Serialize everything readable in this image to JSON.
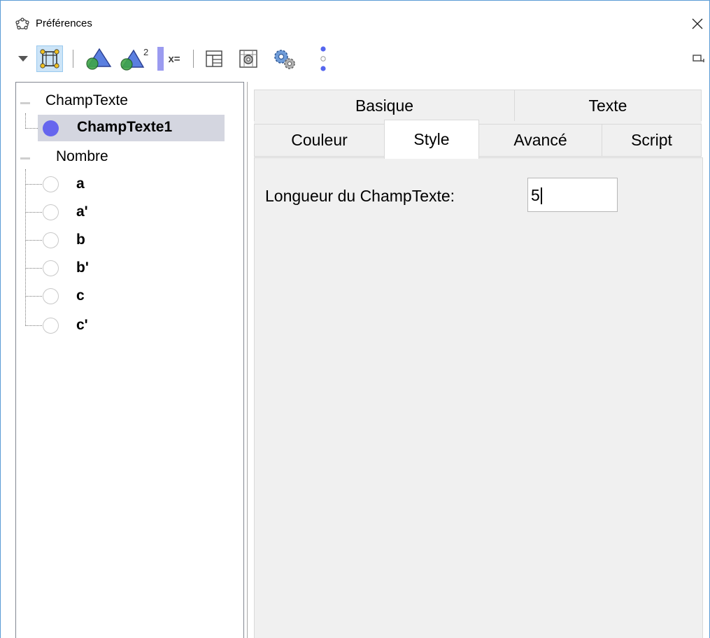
{
  "window": {
    "title": "Préférences",
    "accent_color": "#5a9bd5"
  },
  "toolbar": {
    "items": [
      {
        "name": "dropdown",
        "icon": "triangle-down-icon"
      },
      {
        "name": "graphics",
        "icon": "graphics-view-icon",
        "selected": true
      },
      {
        "name": "graphics-3d",
        "icon": "pyramid-icon"
      },
      {
        "name": "graphics-3d-2",
        "icon": "pyramid-squared-icon",
        "superscript": "2"
      },
      {
        "name": "algebra",
        "icon": "algebra-icon",
        "label": "x="
      },
      {
        "name": "layout",
        "icon": "layout-icon"
      },
      {
        "name": "graphics-settings",
        "icon": "graphics-settings-icon"
      },
      {
        "name": "advanced",
        "icon": "gears-icon"
      },
      {
        "name": "more",
        "icon": "more-vertical-icon"
      },
      {
        "name": "undock",
        "icon": "undock-icon"
      }
    ]
  },
  "tree": {
    "groups": [
      {
        "label": "ChampTexte",
        "children": [
          {
            "label": "ChampTexte1",
            "selected": true,
            "visible": true
          }
        ]
      },
      {
        "label": "Nombre",
        "children": [
          {
            "label": "a",
            "visible": false
          },
          {
            "label": "a'",
            "visible": false
          },
          {
            "label": "b",
            "visible": false
          },
          {
            "label": "b'",
            "visible": false
          },
          {
            "label": "c",
            "visible": false
          },
          {
            "label": "c'",
            "visible": false
          }
        ]
      }
    ],
    "selected_dot_color": "#6666ee"
  },
  "tabs": {
    "row1": [
      {
        "label": "Basique"
      },
      {
        "label": "Texte"
      }
    ],
    "row2": [
      {
        "label": "Couleur"
      },
      {
        "label": "Style",
        "active": true
      },
      {
        "label": "Avancé"
      },
      {
        "label": "Script"
      }
    ]
  },
  "style_tab": {
    "length_label": "Longueur du ChampTexte:",
    "length_value": "5"
  }
}
